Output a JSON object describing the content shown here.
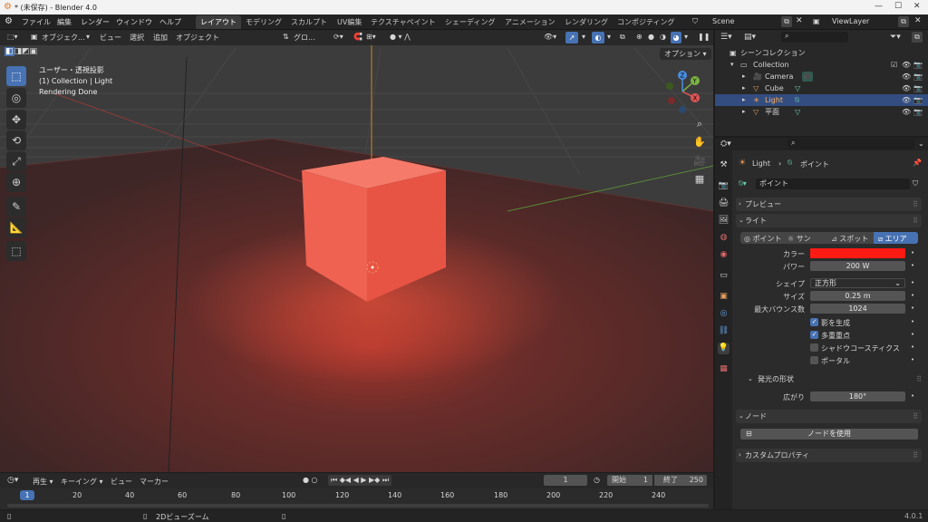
{
  "window": {
    "title": "* (未保存) - Blender 4.0"
  },
  "menus": [
    "ファイル",
    "編集",
    "レンダー",
    "ウィンドウ",
    "ヘルプ"
  ],
  "workspaces": [
    "レイアウト",
    "モデリング",
    "スカルプト",
    "UV編集",
    "テクスチャペイント",
    "シェーディング",
    "アニメーション",
    "レンダリング",
    "コンポジティング"
  ],
  "scene": "Scene",
  "view_layer": "ViewLayer",
  "viewport": {
    "mode": "オブジェク...",
    "menus": [
      "ビュー",
      "選択",
      "追加",
      "オブジェクト"
    ],
    "transform": "グロ...",
    "options": "オプション",
    "overlay": [
      "ユーザー・透視投影",
      "(1) Collection | Light",
      "Rendering Done"
    ],
    "gizmo": {
      "x": "X",
      "y": "Y",
      "z": "Z"
    }
  },
  "outliner": {
    "search_placeholder": "",
    "rows": [
      {
        "label": "シーンコレクション"
      },
      {
        "label": "Collection"
      },
      {
        "label": "Camera"
      },
      {
        "label": "Cube"
      },
      {
        "label": "Light",
        "selected": true
      },
      {
        "label": "平面"
      }
    ]
  },
  "properties": {
    "breadcrumb": [
      "Light",
      "ポイント"
    ],
    "datablock": "ポイント",
    "panels": {
      "preview": "プレビュー",
      "light": "ライト",
      "shape": "発光の形状",
      "nodes": "ノード",
      "custom": "カスタムプロパティ"
    },
    "light_types": [
      "ポイント",
      "サン",
      "スポット",
      "エリア"
    ],
    "active_type": "エリア",
    "labels": {
      "color": "カラー",
      "power": "パワー",
      "shape": "シェイプ",
      "size": "サイズ",
      "max_bounces": "最大バウンス数",
      "spread": "広がり"
    },
    "values": {
      "color": "#ff1a14",
      "power": "200 W",
      "shape": "正方形",
      "size": "0.25 m",
      "max_bounces": "1024",
      "spread": "180°"
    },
    "checks": [
      {
        "label": "影を生成",
        "on": true
      },
      {
        "label": "多重重点",
        "on": true
      },
      {
        "label": "シャドウコースティクス",
        "on": false
      },
      {
        "label": "ポータル",
        "on": false
      }
    ],
    "use_nodes": "ノードを使用"
  },
  "timeline": {
    "menus": [
      "再生",
      "キーイング",
      "ビュー",
      "マーカー"
    ],
    "current_frame": "1",
    "start_label": "開始",
    "start": "1",
    "end_label": "終了",
    "end": "250",
    "ticks": [
      "1",
      "20",
      "40",
      "60",
      "80",
      "100",
      "120",
      "140",
      "160",
      "180",
      "200",
      "220",
      "240"
    ]
  },
  "status": {
    "hint": "2Dビューズーム",
    "version": "4.0.1"
  },
  "colors": {
    "accent": "#4772b3",
    "cube": "#f05a4a",
    "floor": "#4a2a2a"
  }
}
